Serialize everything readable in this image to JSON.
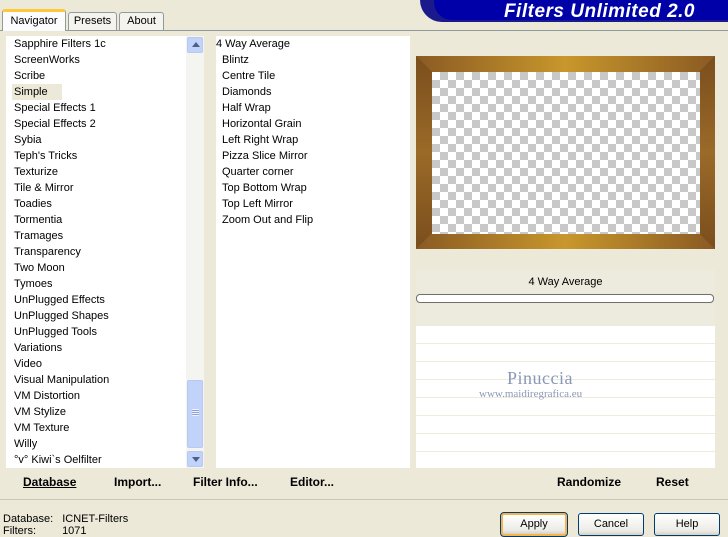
{
  "tabs": [
    {
      "label": "Navigator",
      "active": true
    },
    {
      "label": "Presets",
      "active": false
    },
    {
      "label": "About",
      "active": false
    }
  ],
  "banner": {
    "title": "Filters Unlimited 2.0"
  },
  "categories": [
    "Sapphire Filters 1c",
    "ScreenWorks",
    "Scribe",
    "Simple",
    "Special Effects 1",
    "Special Effects 2",
    "Sybia",
    "Teph's Tricks",
    "Texturize",
    "Tile & Mirror",
    "Toadies",
    "Tormentia",
    "Tramages",
    "Transparency",
    "Two Moon",
    "Tymoes",
    "UnPlugged Effects",
    "UnPlugged Shapes",
    "UnPlugged Tools",
    "Variations",
    "Video",
    "Visual Manipulation",
    "VM Distortion",
    "VM Stylize",
    "VM Texture",
    "Willy",
    "°v° Kiwi`s Oelfilter"
  ],
  "selected_category": "Simple",
  "filters": [
    "4 Way Average",
    "Blintz",
    "Centre Tile",
    "Diamonds",
    "Half Wrap",
    "Horizontal Grain",
    "Left Right Wrap",
    "Pizza Slice Mirror",
    "Quarter corner",
    "Top Bottom Wrap",
    "Top Left Mirror",
    "Zoom Out and Flip"
  ],
  "selected_filter": "4 Way Average",
  "preview": {
    "filter_name": "4 Way Average",
    "frame_color": "#8a5a23",
    "accent_color": "#c8972c"
  },
  "watermark": {
    "line1": "Pinuccia",
    "line2": "www.maidiregrafica.eu"
  },
  "toolbar": {
    "database": "Database",
    "import": "Import...",
    "filter_info": "Filter Info...",
    "editor": "Editor...",
    "randomize": "Randomize",
    "reset": "Reset"
  },
  "status": {
    "db_label": "Database:",
    "db_value": "ICNET-Filters",
    "filters_label": "Filters:",
    "filters_value": "1071"
  },
  "buttons": {
    "apply": "Apply",
    "cancel": "Cancel",
    "help": "Help"
  }
}
